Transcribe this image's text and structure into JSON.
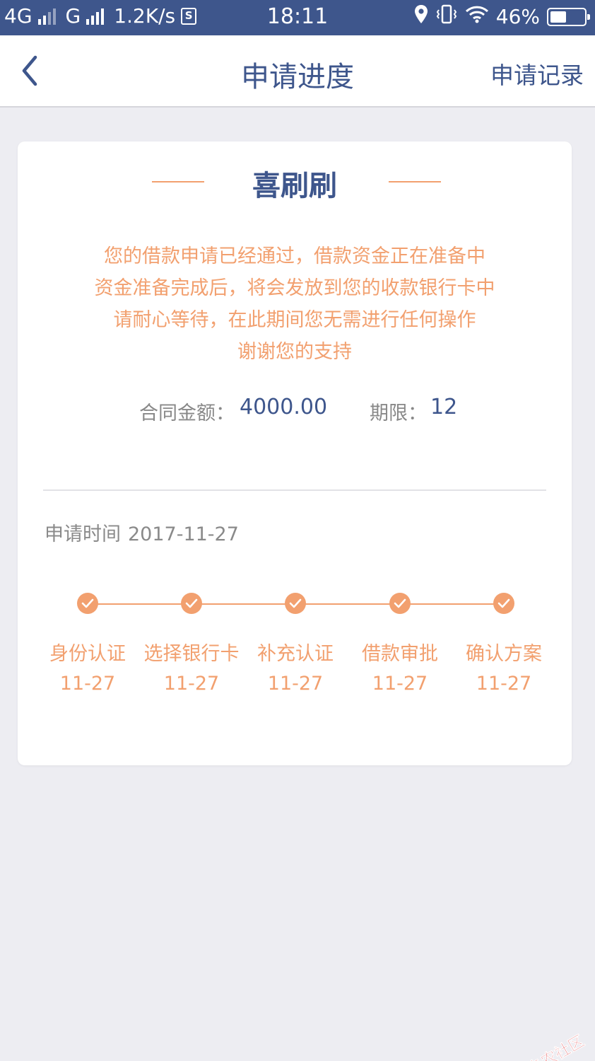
{
  "status_bar": {
    "network_1": "4G",
    "network_2": "G",
    "speed": "1.2K/s",
    "sd_icon_text": "S",
    "time": "18:11",
    "battery": "46%",
    "battery_level": 0.46
  },
  "nav": {
    "back_icon": "chevron-left-icon",
    "title": "申请进度",
    "right_action": "申请记录"
  },
  "card": {
    "title": "喜刷刷",
    "message_lines": [
      "您的借款申请已经通过，借款资金正在准备中",
      "资金准备完成后，将会发放到您的收款银行卡中",
      "请耐心等待，在此期间您无需进行任何操作",
      "谢谢您的支持"
    ],
    "amount_label": "合同金额：",
    "amount_value": "4000.00",
    "term_label": "期限：",
    "term_value": "12",
    "apply_time_label": "申请时间",
    "apply_time_value": "2017-11-27",
    "steps": [
      {
        "name": "身份认证",
        "date": "11-27",
        "icon": "check-icon"
      },
      {
        "name": "选择银行卡",
        "date": "11-27",
        "icon": "check-icon"
      },
      {
        "name": "补充认证",
        "date": "11-27",
        "icon": "check-icon"
      },
      {
        "name": "借款审批",
        "date": "11-27",
        "icon": "check-icon"
      },
      {
        "name": "确认方案",
        "date": "11-27",
        "icon": "check-icon"
      }
    ]
  },
  "watermark": {
    "text": "卡农社区"
  },
  "colors": {
    "primary": "#3e568c",
    "accent": "#f2a06f",
    "background": "#ededf2",
    "watermark": "#d9262c"
  }
}
